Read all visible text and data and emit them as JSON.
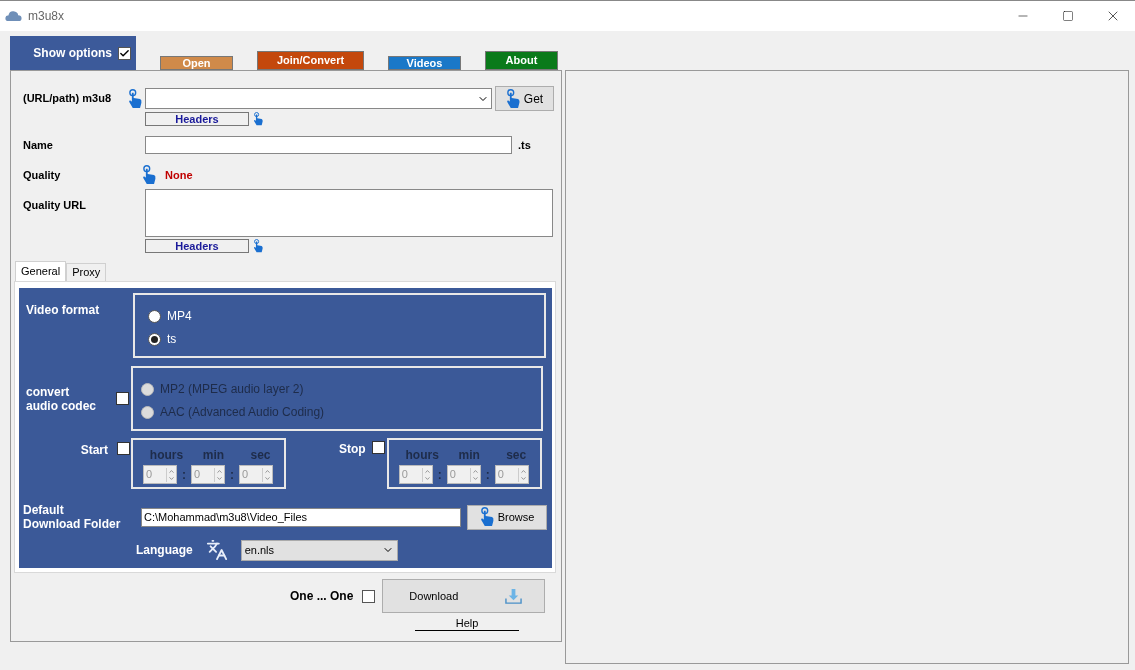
{
  "window": {
    "title": "m3u8x"
  },
  "show_options": {
    "label": "Show options",
    "checked": true
  },
  "nav_buttons": [
    {
      "label": "Open",
      "color": "#d08a4a",
      "raised": false
    },
    {
      "label": "Join/Convert",
      "color": "#c4480c",
      "raised": true
    },
    {
      "label": "Videos",
      "color": "#1a78c8",
      "raised": false
    },
    {
      "label": "About",
      "color": "#0a7a1a",
      "raised": true
    }
  ],
  "url_row": {
    "label": "(URL/path) m3u8",
    "button": "Get",
    "headers_button": "Headers"
  },
  "name_row": {
    "label": "Name",
    "suffix": ".ts"
  },
  "quality": {
    "label": "Quality",
    "value": "None"
  },
  "quality_url": {
    "label": "Quality URL",
    "headers_button": "Headers"
  },
  "tabs": [
    {
      "label": "General",
      "selected": true
    },
    {
      "label": "Proxy",
      "selected": false
    }
  ],
  "video_format": {
    "label": "Video format",
    "options": [
      {
        "label": "MP4",
        "selected": false
      },
      {
        "label": "ts",
        "selected": true
      }
    ]
  },
  "audio_codec": {
    "label": "convert audio codec",
    "checked": false,
    "options": [
      {
        "label": "MP2 (MPEG audio layer 2)",
        "selected": false,
        "disabled": true
      },
      {
        "label": "AAC (Advanced Audio Coding)",
        "selected": false,
        "disabled": true
      }
    ]
  },
  "start": {
    "label": "Start",
    "checked": false,
    "units": [
      "hours",
      "min",
      "sec"
    ],
    "values": [
      "0",
      "0",
      "0"
    ],
    "separators": [
      ":",
      ":"
    ]
  },
  "stop": {
    "label": "Stop",
    "checked": false,
    "units": [
      "hours",
      "min",
      "sec"
    ],
    "values": [
      "0",
      "0",
      "0"
    ],
    "separators": [
      ":",
      ":"
    ]
  },
  "download_folder": {
    "label": "Default Download Folder",
    "value": "C:\\Mohammad\\m3u8\\Video_Files",
    "button": "Browse"
  },
  "language": {
    "label": "Language",
    "value": "en.nls"
  },
  "one_by_one": {
    "label": "One ... One",
    "checked": false
  },
  "download_button": "Download",
  "help_link": "Help"
}
